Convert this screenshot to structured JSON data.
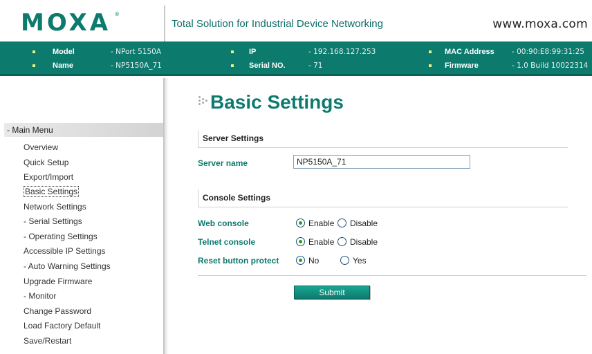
{
  "header": {
    "logo_text": "MOXA",
    "logo_mark": "®",
    "slogan": "Total Solution for Industrial Device Networking",
    "website": "www.moxa.com"
  },
  "info": {
    "model_label": "Model",
    "model_value": "- NPort 5150A",
    "name_label": "Name",
    "name_value": "- NP5150A_71",
    "ip_label": "IP",
    "ip_value": "- 192.168.127.253",
    "serial_label": "Serial NO.",
    "serial_value": "- 71",
    "mac_label": "MAC Address",
    "mac_value": "- 00:90:E8:99:31:25",
    "firmware_label": "Firmware",
    "firmware_value": "- 1.0 Build 10022314"
  },
  "menu": {
    "header": "- Main Menu",
    "items": [
      "Overview",
      "Quick Setup",
      "Export/Import",
      "Basic Settings",
      "Network Settings",
      "- Serial Settings",
      "- Operating Settings",
      "Accessible IP Settings",
      "- Auto Warning Settings",
      "Upgrade Firmware",
      "- Monitor",
      "Change Password",
      "Load Factory Default",
      "Save/Restart"
    ],
    "active": "Basic Settings"
  },
  "page": {
    "title": "Basic Settings",
    "server_section": "Server Settings",
    "server_name_label": "Server name",
    "server_name_value": "NP5150A_71",
    "console_section": "Console Settings",
    "web_console_label": "Web console",
    "telnet_console_label": "Telnet console",
    "reset_protect_label": "Reset button protect",
    "enable": "Enable",
    "disable": "Disable",
    "no": "No",
    "yes": "Yes",
    "web_console_value": "Enable",
    "telnet_console_value": "Enable",
    "reset_protect_value": "No",
    "submit": "Submit"
  },
  "colors": {
    "brand": "#0d7a6e",
    "bullet": "#e8f27c"
  }
}
